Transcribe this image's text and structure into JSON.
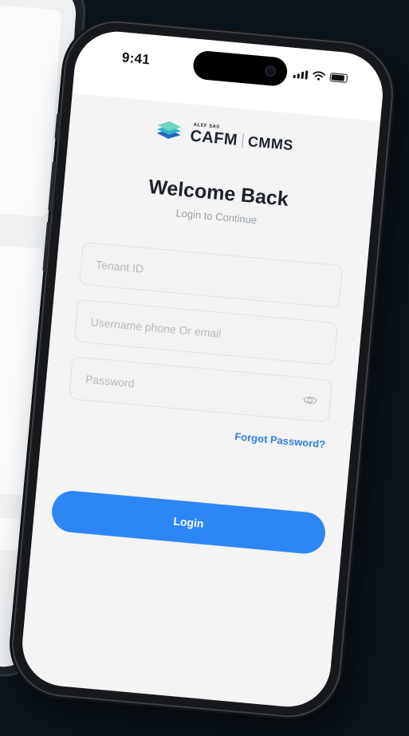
{
  "status_bar": {
    "time": "9:41"
  },
  "logo": {
    "small_text": "ALEF SAS",
    "primary": "CAFM",
    "secondary": "CMMS"
  },
  "login": {
    "title": "Welcome Back",
    "subtitle": "Login to Continue",
    "tenant_placeholder": "Tenant ID",
    "username_placeholder": "Username phone Or email",
    "password_placeholder": "Password",
    "forgot_label": "Forgot Password?",
    "submit_label": "Login"
  },
  "icons": {
    "password_toggle": "eye-icon",
    "signal": "signal-icon",
    "wifi": "wifi-icon",
    "battery": "battery-icon"
  },
  "colors": {
    "accent": "#2d86f4",
    "link": "#2f80e8",
    "background": "#0b141b",
    "screen": "#f3f4f3"
  }
}
